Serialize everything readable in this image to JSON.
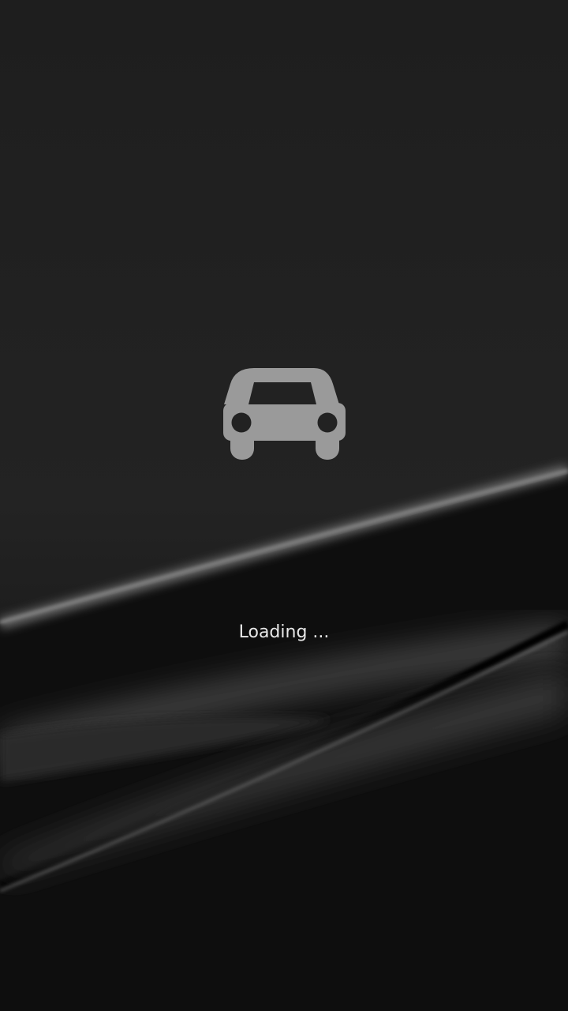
{
  "splash": {
    "icon": "car-icon",
    "icon_color": "#9a9a9a",
    "loading_text": "Loading ..."
  },
  "colors": {
    "background": "#1f1f1f",
    "text": "#e8e8e8"
  }
}
